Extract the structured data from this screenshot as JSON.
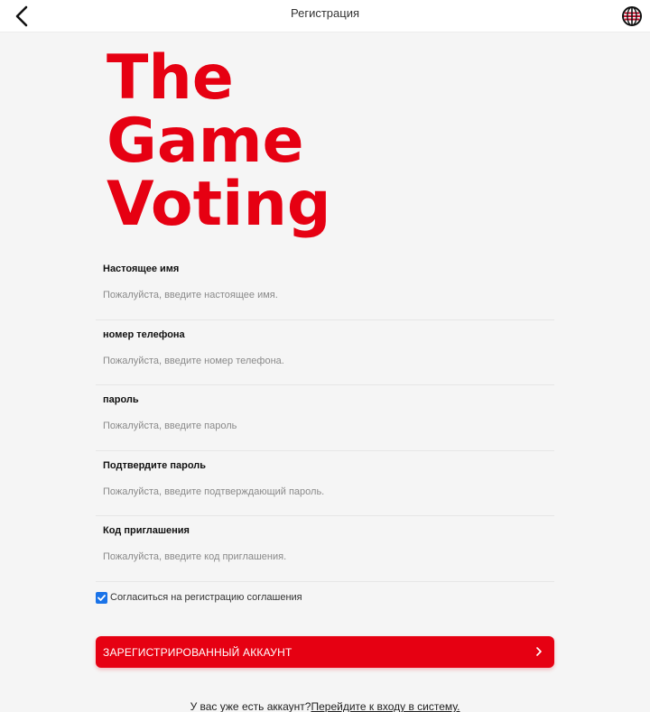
{
  "header": {
    "title": "Регистрация",
    "back_icon": "chevron-left-icon",
    "language_icon": "globe-flag-icon"
  },
  "logo": {
    "line1": "The",
    "line2": "Game",
    "line3": "Voting",
    "color": "#e60012"
  },
  "form": {
    "fields": [
      {
        "label": "Настоящее имя",
        "value": "",
        "placeholder": "Пожалуйста, введите настоящее имя."
      },
      {
        "label": "номер телефона",
        "value": "",
        "placeholder": "Пожалуйста, введите номер телефона."
      },
      {
        "label": "пароль",
        "value": "",
        "placeholder": "Пожалуйста, введите пароль"
      },
      {
        "label": "Подтвердите пароль",
        "value": "",
        "placeholder": "Пожалуйста, введите подтверждающий пароль."
      },
      {
        "label": "Код приглашения",
        "value": "",
        "placeholder": "Пожалуйста, введите код приглашения."
      }
    ]
  },
  "agreement": {
    "checked": true,
    "label": "Согласиться на регистрацию соглашения"
  },
  "register_button": {
    "label": "ЗАРЕГИСТРИРОВАННЫЙ АККАУНТ",
    "icon": "chevron-right-icon",
    "color": "#e60012"
  },
  "login_prompt": {
    "text": "У вас уже есть аккаунт?",
    "link": "Перейдите к входу в систему."
  },
  "colors": {
    "accent": "#e60012",
    "checkbox": "#1a73e8",
    "background": "#f5f5f5"
  }
}
